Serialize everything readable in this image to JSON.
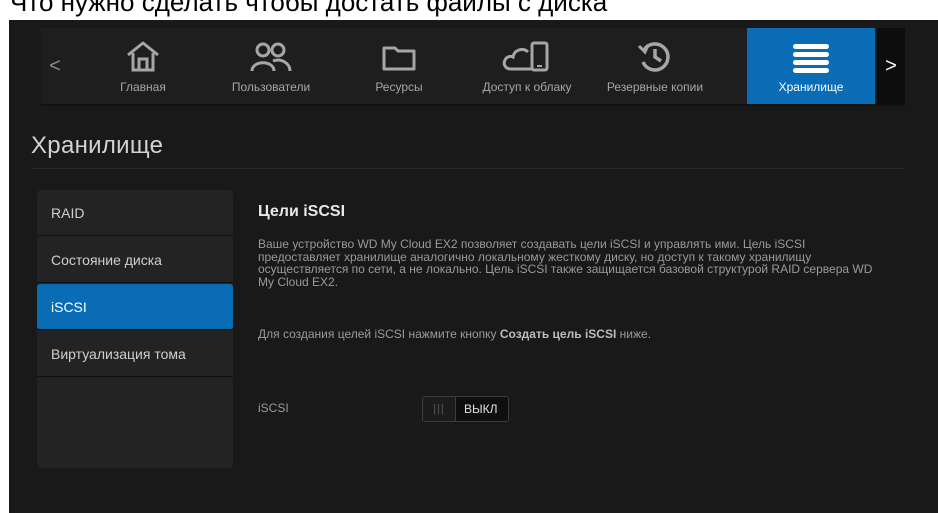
{
  "top_caption": "Что нужно сделать чтобы достать файлы с диска",
  "nav": {
    "items": [
      {
        "label": "Главная",
        "icon": "home-icon"
      },
      {
        "label": "Пользователи",
        "icon": "users-icon"
      },
      {
        "label": "Ресурсы",
        "icon": "folder-icon"
      },
      {
        "label": "Доступ к облаку",
        "icon": "cloud-device-icon"
      },
      {
        "label": "Резервные копии",
        "icon": "backup-history-icon"
      },
      {
        "label": "Хранилище",
        "icon": "storage-icon"
      }
    ],
    "active": "Хранилище",
    "prev_arrow": "<",
    "next_arrow": ">"
  },
  "page_title": "Хранилище",
  "sidebar": {
    "items": [
      {
        "label": "RAID"
      },
      {
        "label": "Состояние диска"
      },
      {
        "label": "iSCSI"
      },
      {
        "label": "Виртуализация тома"
      }
    ],
    "active": "iSCSI"
  },
  "content": {
    "title": "Цели iSCSI",
    "description": "Ваше устройство WD My Cloud EX2 позволяет создавать цели iSCSI и управлять ими. Цель iSCSI предоставляет хранилище аналогично локальному жесткому диску, но доступ к такому хранилищу осуществляется по сети, а не локально. Цель iSCSI также защищается базовой структурой RAID сервера WD My Cloud EX2.",
    "hint_prefix": "Для создания целей iSCSI нажмите кнопку ",
    "hint_button": "Создать цель iSCSI",
    "hint_suffix": " ниже.",
    "toggle_label": "iSCSI",
    "toggle_grip": "|||",
    "toggle_state": "ВЫКЛ"
  },
  "colors": {
    "accent": "#0b6cb6",
    "background": "#191919",
    "panel": "#232323"
  }
}
